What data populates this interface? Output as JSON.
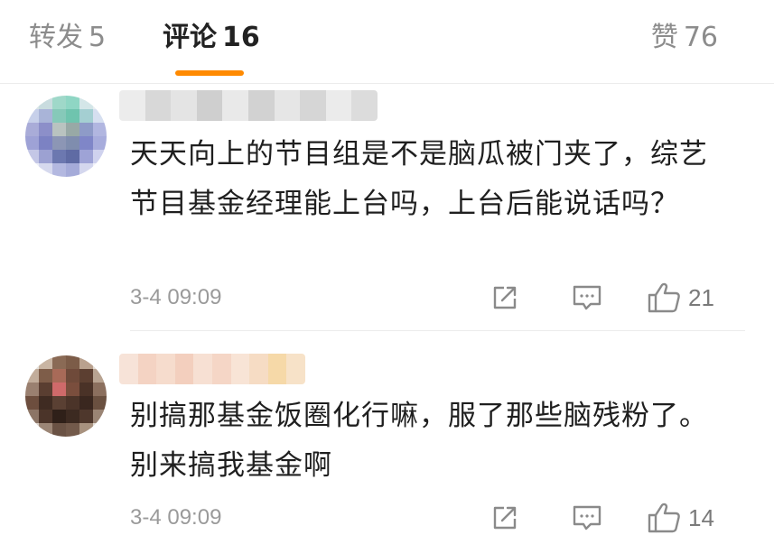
{
  "tabs": {
    "repost": {
      "label": "转发",
      "count": "5"
    },
    "comment": {
      "label": "评论",
      "count": "16"
    },
    "like": {
      "label": "赞",
      "count": "76"
    }
  },
  "comments": [
    {
      "text": "天天向上的节目组是不是脑瓜被门夹了，综艺节目基金经理能上台吗，上台后能说话吗？",
      "timestamp": "3-4 09:09",
      "likes": "21"
    },
    {
      "text": "别搞那基金饭圈化行嘛，服了那些脑残粉了。别来搞我基金啊",
      "timestamp": "3-4 09:09",
      "likes": "14"
    }
  ],
  "icons": {
    "share": "share-icon",
    "reply": "comment-icon",
    "like": "thumbs-up-icon"
  },
  "colors": {
    "accent": "#ff8a00",
    "muted_text": "#9a9a9a",
    "primary_text": "#1f1f1f"
  }
}
